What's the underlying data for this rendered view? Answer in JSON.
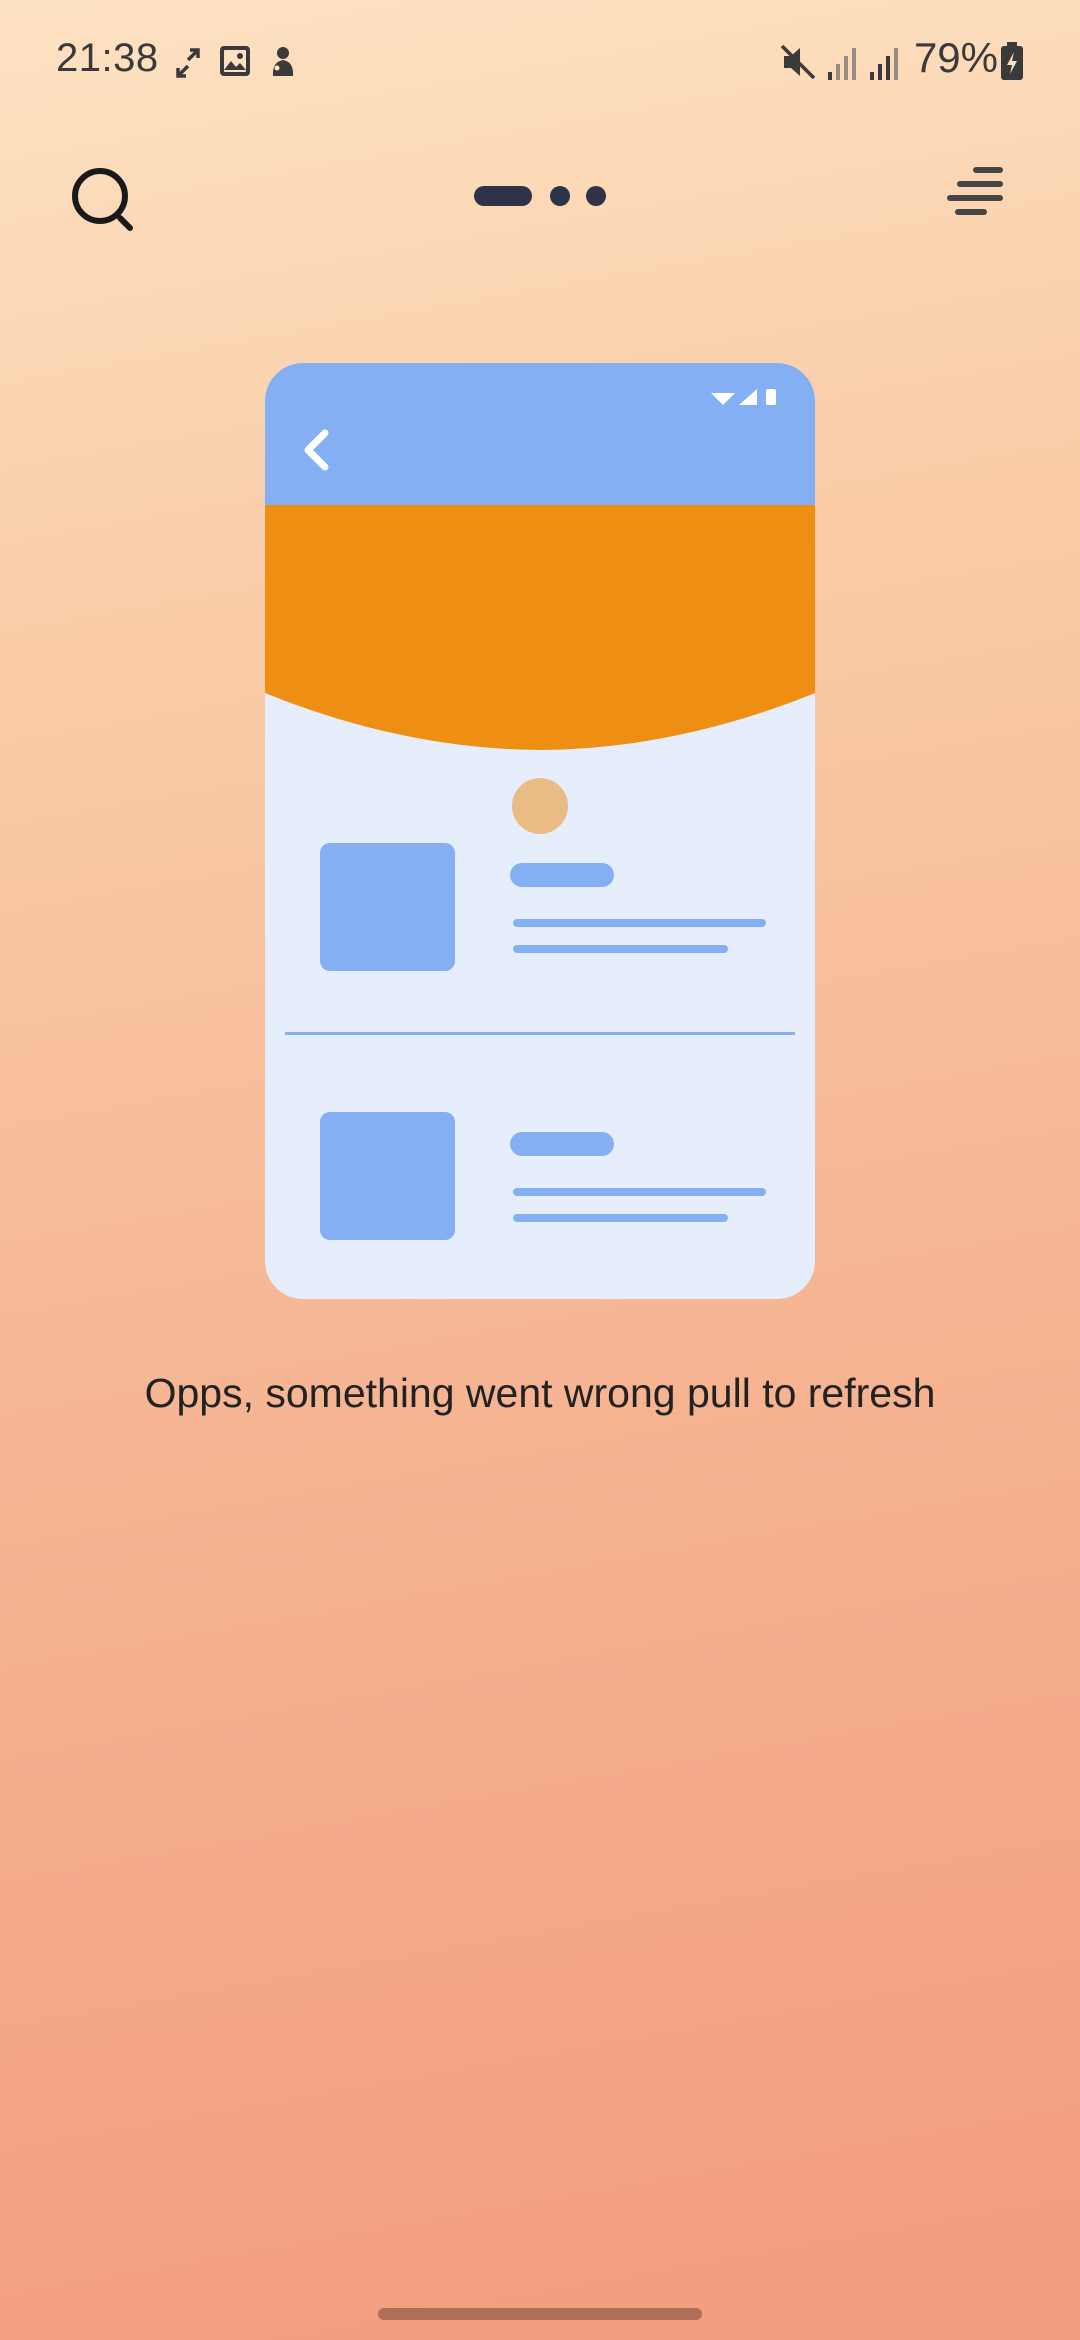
{
  "status_bar": {
    "time": "21:38",
    "battery": "79%",
    "icons": [
      "expand-icon",
      "gallery-icon",
      "app-notification-icon",
      "mute-icon",
      "signal-icon",
      "signal-icon",
      "battery-charging-icon"
    ]
  },
  "app_bar": {
    "search_icon": "search-icon",
    "menu_icon": "menu-icon",
    "page_indicator": {
      "count": 3,
      "active": 0
    }
  },
  "error": {
    "message": "Opps, something went wrong pull to refresh"
  },
  "colors": {
    "illustration_blue": "#84b0f3",
    "illustration_orange": "#ee8e13",
    "illustration_bg": "#e7eefb",
    "avatar": "#e9bb85"
  }
}
